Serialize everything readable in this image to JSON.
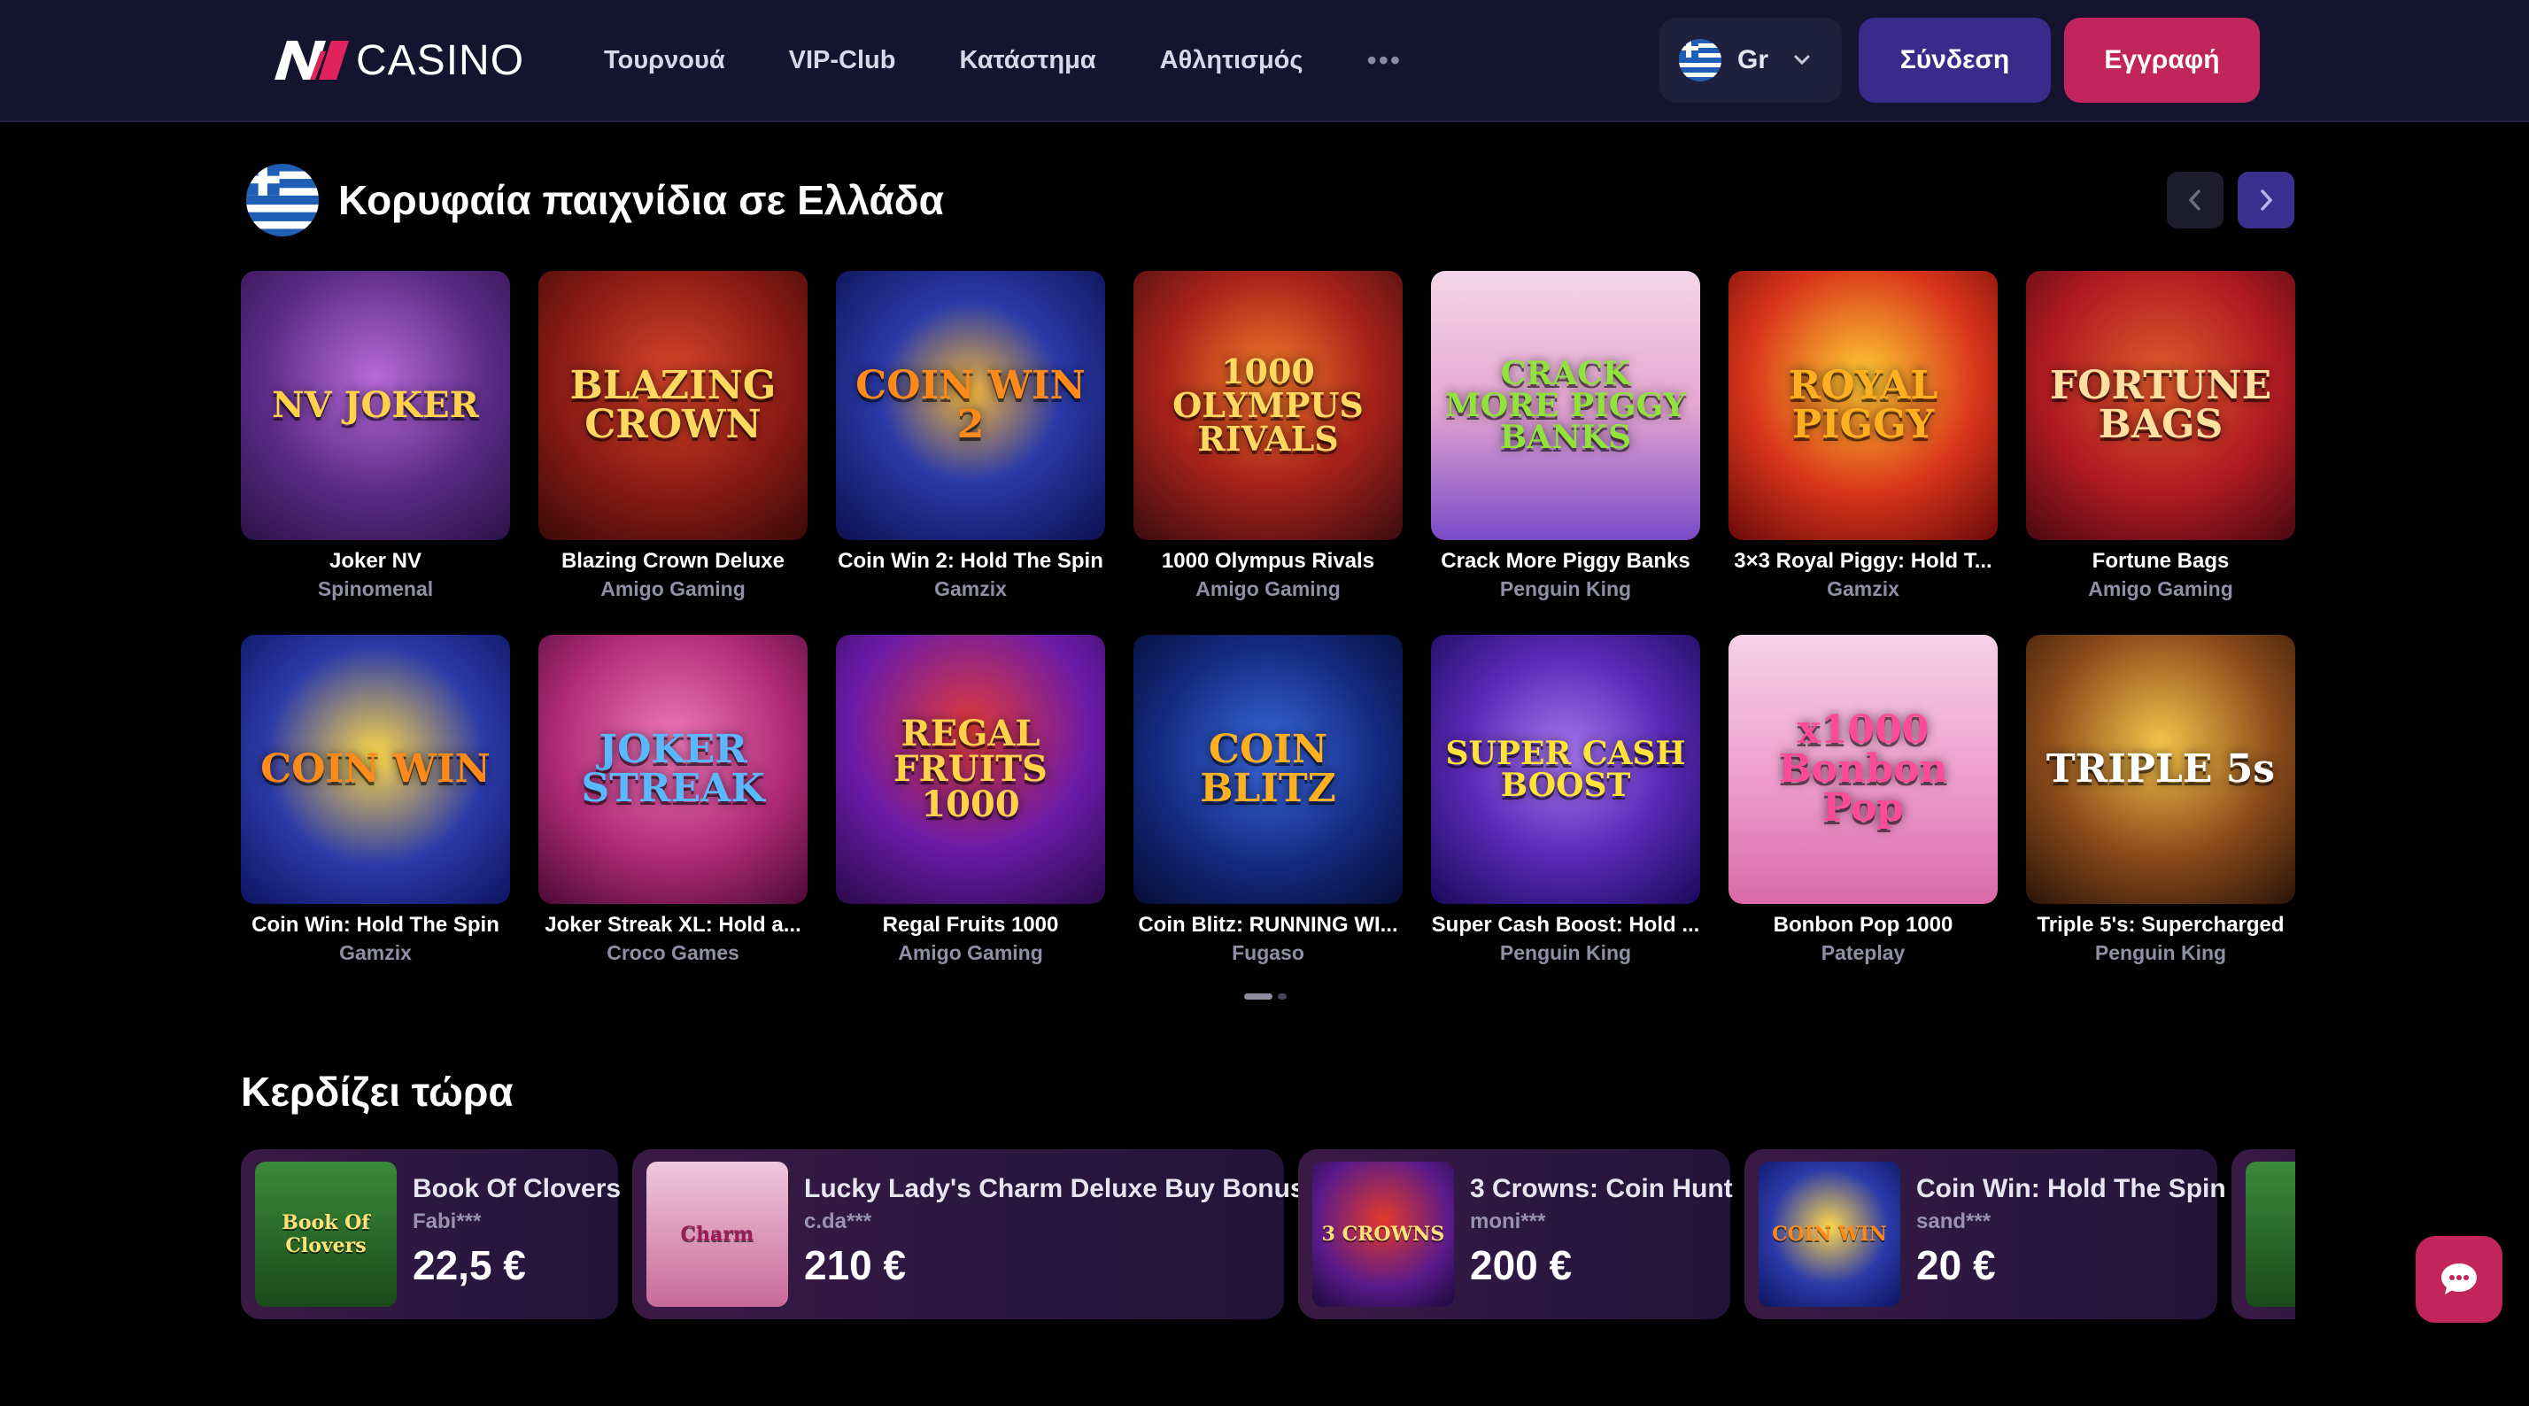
{
  "header": {
    "logo_mark": "NV",
    "logo_word": "CASINO",
    "nav": [
      "Τουρνουά",
      "VIP-Club",
      "Κατάστημα",
      "Αθλητισμός"
    ],
    "more": "•••",
    "language": "Gr",
    "login": "Σύνδεση",
    "register": "Εγγραφή"
  },
  "top_games": {
    "title": "Κορυφαία παιχνίδια σε Ελλάδα",
    "games": [
      {
        "name": "Joker NV",
        "provider": "Spinomenal",
        "art": "NV JOKER"
      },
      {
        "name": "Blazing Crown Deluxe",
        "provider": "Amigo Gaming",
        "art": "BLAZING CROWN"
      },
      {
        "name": "Coin Win 2: Hold The Spin",
        "provider": "Gamzix",
        "art": "COIN WIN 2"
      },
      {
        "name": "1000 Olympus Rivals",
        "provider": "Amigo Gaming",
        "art": "1000 OLYMPUS RIVALS"
      },
      {
        "name": "Crack More Piggy Banks",
        "provider": "Penguin King",
        "art": "CRACK MORE PIGGY BANKS"
      },
      {
        "name": "3×3 Royal Piggy: Hold T...",
        "provider": "Gamzix",
        "art": "ROYAL PIGGY"
      },
      {
        "name": "Fortune Bags",
        "provider": "Amigo Gaming",
        "art": "FORTUNE BAGS"
      },
      {
        "name": "Coin Win: Hold The Spin",
        "provider": "Gamzix",
        "art": "COIN WIN"
      },
      {
        "name": "Joker Streak XL: Hold a...",
        "provider": "Croco Games",
        "art": "JOKER STREAK"
      },
      {
        "name": "Regal Fruits 1000",
        "provider": "Amigo Gaming",
        "art": "REGAL FRUITS 1000"
      },
      {
        "name": "Coin Blitz: RUNNING WI...",
        "provider": "Fugaso",
        "art": "COIN BLITZ"
      },
      {
        "name": "Super Cash Boost: Hold ...",
        "provider": "Penguin King",
        "art": "SUPER CASH BOOST"
      },
      {
        "name": "Bonbon Pop 1000",
        "provider": "Pateplay",
        "art": "x1000 Bonbon Pop"
      },
      {
        "name": "Triple 5's: Supercharged",
        "provider": "Penguin King",
        "art": "TRIPLE 5s"
      }
    ]
  },
  "wins": {
    "title": "Κερδίζει τώρα",
    "items": [
      {
        "game": "Book Of Clovers",
        "user": "Fabi***",
        "amount": "22,5 €",
        "art": "Book Of Clovers"
      },
      {
        "game": "Lucky Lady's Charm Deluxe Buy Bonus",
        "user": "c.da***",
        "amount": "210 €",
        "art": "Charm"
      },
      {
        "game": "3 Crowns: Coin Hunt",
        "user": "moni***",
        "amount": "200 €",
        "art": "3 CROWNS"
      },
      {
        "game": "Coin Win: Hold The Spin",
        "user": "sand***",
        "amount": "20 €",
        "art": "COIN WIN"
      }
    ]
  },
  "colors": {
    "topbar": "#14142e",
    "login": "#3a2a8a",
    "register": "#c2255c",
    "chat": "#c2255c"
  },
  "icons": [
    "greece-flag-icon",
    "chevron-down-icon",
    "chevron-left-icon",
    "chevron-right-icon",
    "chat-icon"
  ]
}
